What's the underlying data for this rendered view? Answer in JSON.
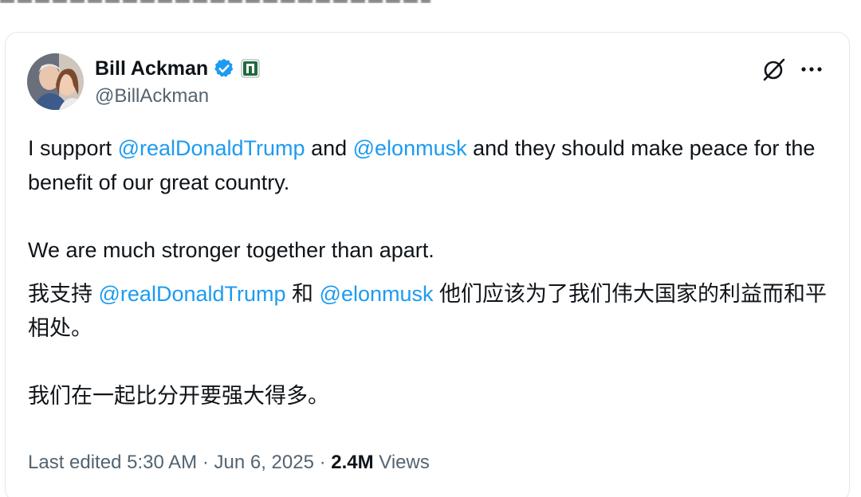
{
  "author": {
    "display_name": "Bill Ackman",
    "handle": "@BillAckman"
  },
  "icons": {
    "verified": "verified-badge-icon",
    "affiliation": "affiliation-badge-icon",
    "grok": "grok-icon",
    "more": "more-options-icon"
  },
  "colors": {
    "mention": "#1d9bf0",
    "verified": "#1d9bf0",
    "text": "#0f1419",
    "secondary": "#536471"
  },
  "tweet": {
    "p1": {
      "t1": "I support ",
      "m1": "@realDonaldTrump",
      "t2": " and ",
      "m2": "@elonmusk",
      "t3": " and they should make peace for the benefit of our great country."
    },
    "p2": "We are much stronger together than apart.",
    "p3": {
      "t1": "我支持 ",
      "m1": "@realDonaldTrump",
      "t2": " 和 ",
      "m2": "@elonmusk",
      "t3": " 他们应该为了我们伟大国家的利益而和平相处。"
    },
    "p4": "我们在一起比分开要强大得多。"
  },
  "meta": {
    "edited_prefix": "Last edited ",
    "time": "5:30 AM",
    "sep1": " · ",
    "date": "Jun 6, 2025",
    "sep2": " · ",
    "views_count": "2.4M",
    "views_label": " Views"
  }
}
